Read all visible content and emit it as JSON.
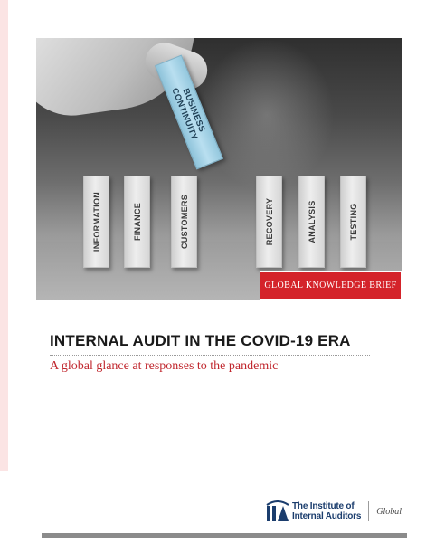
{
  "cover": {
    "blocks": [
      "INFORMATION",
      "FINANCE",
      "CUSTOMERS",
      "RECOVERY",
      "ANALYSIS",
      "TESTING"
    ],
    "lifted_block": {
      "line1": "BUSINESS",
      "line2": "CONTINUITY"
    },
    "badge": "GLOBAL KNOWLEDGE BRIEF",
    "title": "INTERNAL AUDIT IN THE COVID-19 ERA",
    "subtitle": "A global glance at responses to the pandemic"
  },
  "logo": {
    "line1": "The Institute of",
    "line2": "Internal Auditors",
    "region": "Global",
    "icon": "iia-logo-icon"
  },
  "colors": {
    "accent_red": "#d4232a",
    "subtitle_red": "#c0262d",
    "logo_blue": "#1b3d6d",
    "block_blue": "#b9dff0"
  }
}
